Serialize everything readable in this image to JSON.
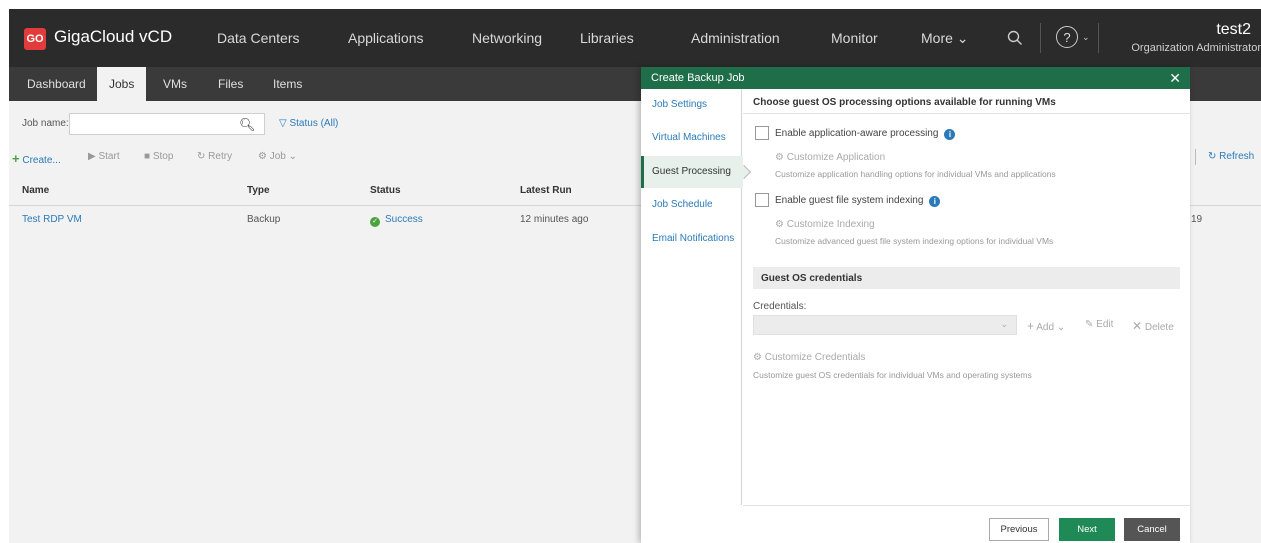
{
  "topnav": {
    "logo_text": "GO",
    "brand": "GigaCloud vCD",
    "items": [
      {
        "label": "Data Centers"
      },
      {
        "label": "Applications"
      },
      {
        "label": "Networking"
      },
      {
        "label": "Libraries"
      },
      {
        "label": "Administration"
      },
      {
        "label": "Monitor"
      },
      {
        "label": "More ⌄"
      }
    ],
    "help_icon": "?",
    "help_caret": "⌄",
    "user": {
      "name": "test2",
      "role": "Organization Administrator"
    }
  },
  "subnav": {
    "tabs": [
      {
        "label": "Dashboard"
      },
      {
        "label": "Jobs"
      },
      {
        "label": "VMs"
      },
      {
        "label": "Files"
      },
      {
        "label": "Items"
      }
    ],
    "active": "Jobs"
  },
  "jobs": {
    "filter": {
      "label": "Job name:",
      "value": "",
      "status_filter": "Status (All)"
    },
    "toolbar": {
      "create": "Create...",
      "start": "Start",
      "stop": "Stop",
      "retry": "Retry",
      "job": "Job ⌄",
      "refresh": "Refresh"
    },
    "columns": [
      "Name",
      "Type",
      "Status",
      "Latest Run"
    ],
    "rows": [
      {
        "name": "Test RDP VM",
        "type": "Backup",
        "status": "Success",
        "latest_run": "12 minutes ago",
        "trailing": "19"
      }
    ]
  },
  "modal": {
    "title": "Create Backup Job",
    "close": "✕",
    "steps": [
      {
        "label": "Job Settings"
      },
      {
        "label": "Virtual Machines"
      },
      {
        "label": "Guest Processing"
      },
      {
        "label": "Job Schedule"
      },
      {
        "label": "Email Notifications"
      }
    ],
    "active_step": "Guest Processing",
    "section_title": "Choose guest OS processing options available for running VMs",
    "app_aware": {
      "label": "Enable application-aware processing",
      "checked": false,
      "customize_link": "Customize Application",
      "customize_desc": "Customize application handling options for individual VMs and applications"
    },
    "indexing": {
      "label": "Enable guest file system indexing",
      "checked": false,
      "customize_link": "Customize Indexing",
      "customize_desc": "Customize advanced guest file system indexing options for individual VMs"
    },
    "credentials": {
      "section_title": "Guest OS credentials",
      "label": "Credentials:",
      "value": "",
      "add": "Add ⌄",
      "edit": "Edit",
      "delete": "Delete",
      "customize_link": "Customize Credentials",
      "customize_desc": "Customize guest OS credentials for individual VMs and operating systems"
    },
    "buttons": {
      "previous": "Previous",
      "next": "Next",
      "cancel": "Cancel"
    }
  }
}
